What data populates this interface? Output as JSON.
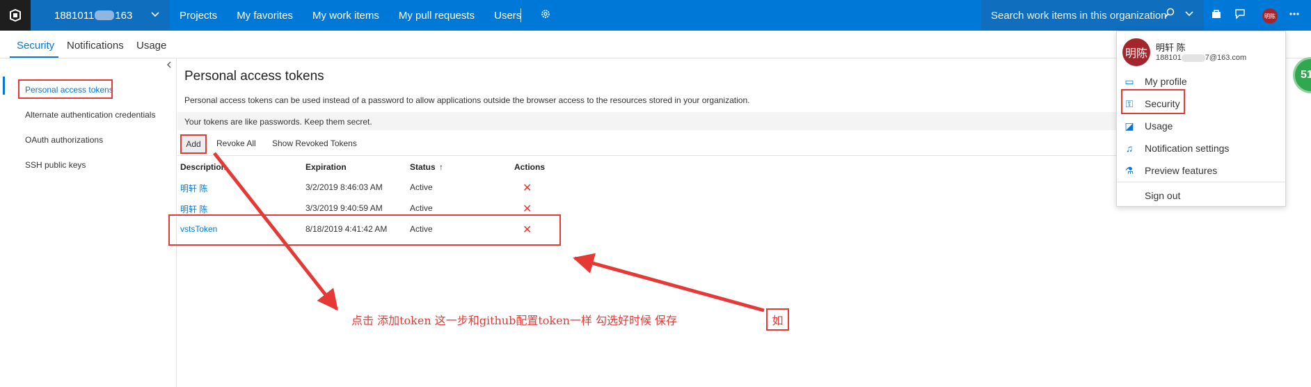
{
  "topbar": {
    "account_prefix": "1881011",
    "account_suffix": "163",
    "nav": [
      "Projects",
      "My favorites",
      "My work items",
      "My pull requests",
      "Users"
    ],
    "search_placeholder": "Search work items in this organization",
    "avatar_initials": "明陈",
    "icons": [
      "azure-devops-logo-icon",
      "chevron-down-icon",
      "gear-icon",
      "search-icon",
      "shopping-bag-icon",
      "feedback-icon",
      "more-icon"
    ]
  },
  "subtabs": [
    "Security",
    "Notifications",
    "Usage"
  ],
  "sidebar": {
    "items": [
      "Personal access tokens",
      "Alternate authentication credentials",
      "OAuth authorizations",
      "SSH public keys"
    ]
  },
  "main": {
    "title": "Personal access tokens",
    "description": "Personal access tokens can be used instead of a password to allow applications outside the browser access to the resources stored in your organization.",
    "warning": "Your tokens are like passwords. Keep them secret.",
    "toolbar": {
      "add": "Add",
      "revoke_all": "Revoke All",
      "show_revoked": "Show Revoked Tokens"
    },
    "columns": [
      "Description",
      "Expiration",
      "Status",
      "Actions"
    ],
    "sort_indicator": "↑",
    "rows": [
      {
        "description": "明轩 陈",
        "expiration": "3/2/2019 8:46:03 AM",
        "status": "Active"
      },
      {
        "description": "明轩 陈",
        "expiration": "3/3/2019 9:40:59 AM",
        "status": "Active"
      },
      {
        "description": "vstsToken",
        "expiration": "8/18/2019 4:41:42 AM",
        "status": "Active"
      }
    ]
  },
  "menu": {
    "avatar_initials": "明陈",
    "name": "明轩 陈",
    "email_prefix": "188101",
    "email_suffix": "7@163.com",
    "items": [
      "My profile",
      "Security",
      "Usage",
      "Notification settings",
      "Preview features"
    ],
    "sign_out": "Sign out"
  },
  "badge": "51",
  "annotation": {
    "text": "点击  添加token 这一步和github配置token一样 勾选好时候 保存",
    "boxed_char": "如"
  },
  "colors": {
    "brand": "#0078d7",
    "annotation": "#e53935",
    "avatar": "#a4262c"
  }
}
